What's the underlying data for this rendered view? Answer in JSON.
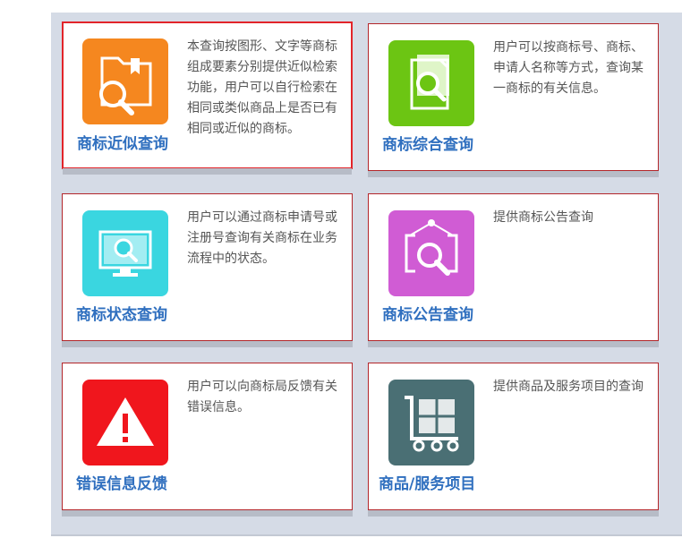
{
  "cards": [
    {
      "title": "商标近似查询",
      "desc": "本查询按图形、文字等商标组成要素分别提供近似检索功能，用户可以自行检索在相同或类似商品上是否已有相同或近似的商标。",
      "icon": "folder-search-icon",
      "color": "#f5871f",
      "selected": true
    },
    {
      "title": "商标综合查询",
      "desc": "用户可以按商标号、商标、申请人名称等方式，查询某一商标的有关信息。",
      "icon": "document-search-icon",
      "color": "#6cc513"
    },
    {
      "title": "商标状态查询",
      "desc": "用户可以通过商标申请号或注册号查询有关商标在业务流程中的状态。",
      "icon": "monitor-search-icon",
      "color": "#3ad6e0"
    },
    {
      "title": "商标公告查询",
      "desc": "提供商标公告查询",
      "icon": "notice-search-icon",
      "color": "#d05cd4"
    },
    {
      "title": "错误信息反馈",
      "desc": "用户可以向商标局反馈有关错误信息。",
      "icon": "warning-icon",
      "color": "#f0161d"
    },
    {
      "title": "商品/服务项目",
      "desc": "提供商品及服务项目的查询",
      "icon": "cart-icon",
      "color": "#4a6f74"
    }
  ]
}
